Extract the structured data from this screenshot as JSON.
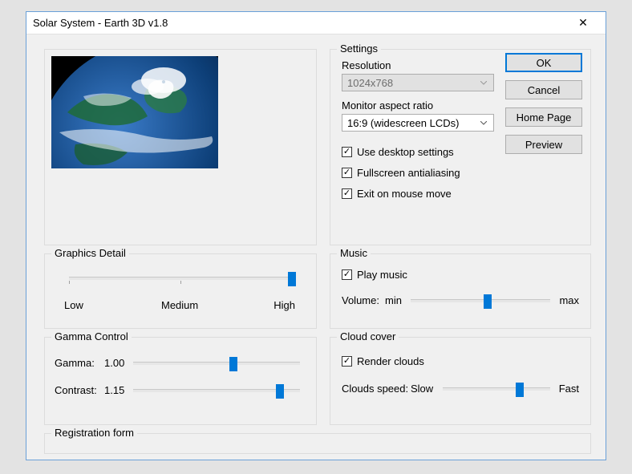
{
  "window": {
    "title": "Solar System - Earth 3D v1.8"
  },
  "buttons": {
    "ok": "OK",
    "cancel": "Cancel",
    "home": "Home Page",
    "preview": "Preview"
  },
  "settings": {
    "heading": "Settings",
    "resolution_label": "Resolution",
    "resolution_value": "1024x768",
    "aspect_label": "Monitor aspect ratio",
    "aspect_value": "16:9 (widescreen LCDs)",
    "use_desktop": "Use desktop settings",
    "fullscreen_aa": "Fullscreen antialiasing",
    "exit_mouse": "Exit on mouse move"
  },
  "graphics": {
    "heading": "Graphics Detail",
    "low": "Low",
    "medium": "Medium",
    "high": "High"
  },
  "gamma": {
    "heading": "Gamma Control",
    "gamma_label": "Gamma:",
    "gamma_value": "1.00",
    "contrast_label": "Contrast:",
    "contrast_value": "1.15"
  },
  "music": {
    "heading": "Music",
    "play": "Play music",
    "volume_label": "Volume:",
    "min": "min",
    "max": "max"
  },
  "cloud": {
    "heading": "Cloud cover",
    "render": "Render clouds",
    "speed_label": "Clouds speed:",
    "slow": "Slow",
    "fast": "Fast"
  },
  "reg": {
    "heading": "Registration form"
  }
}
